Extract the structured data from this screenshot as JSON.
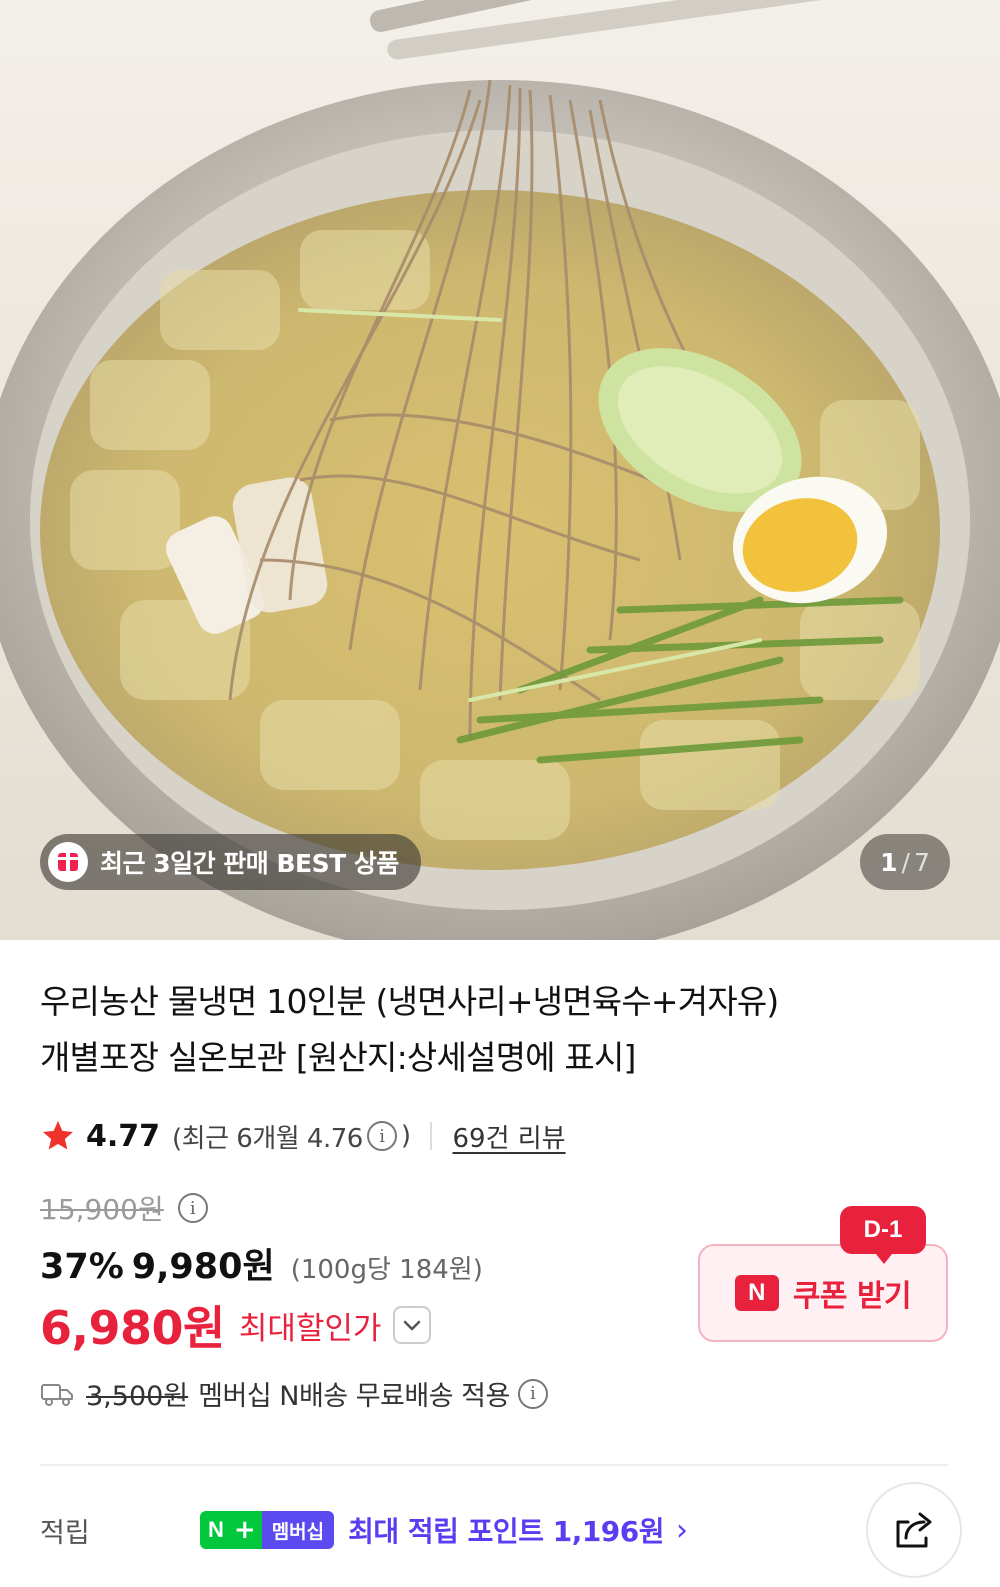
{
  "hero": {
    "badge_text": "최근 3일간 판매 BEST 상품",
    "image_index": "1",
    "image_separator": "/",
    "image_total": "7"
  },
  "product": {
    "title_line1": "우리농산 물냉면 10인분 (냉면사리+냉면육수+겨자유)",
    "title_line2": "개별포장 실온보관 [원산지:상세설명에 표시]"
  },
  "rating": {
    "score": "4.77",
    "recent_prefix": "(최근 6개월 4.76",
    "recent_suffix": ")",
    "review_link": "69건 리뷰"
  },
  "price": {
    "original": "15,900원",
    "discount_rate": "37%",
    "sale_price": "9,980원",
    "unit_price": "(100g당 184원)",
    "max_discount_price": "6,980원",
    "max_discount_label": "최대할인가"
  },
  "coupon": {
    "dday": "D-1",
    "logo": "N",
    "label": "쿠폰 받기"
  },
  "shipping": {
    "old_fee": "3,500원",
    "text": "멤버십 N배송 무료배송 적용"
  },
  "points": {
    "label": "적립",
    "badge_n": "N",
    "badge_plus": "+",
    "badge_membership": "멤버십",
    "text": "최대 적립 포인트 1,196원",
    "chevron": "›"
  },
  "icons": {
    "gift": "gift-icon",
    "star": "star-icon",
    "info": "info-icon",
    "chevron_down": "chevron-down-icon",
    "truck": "truck-icon",
    "share": "share-icon"
  },
  "colors": {
    "accent_red": "#e8213d",
    "points_purple": "#5a3df0",
    "naver_green": "#00c73c"
  }
}
